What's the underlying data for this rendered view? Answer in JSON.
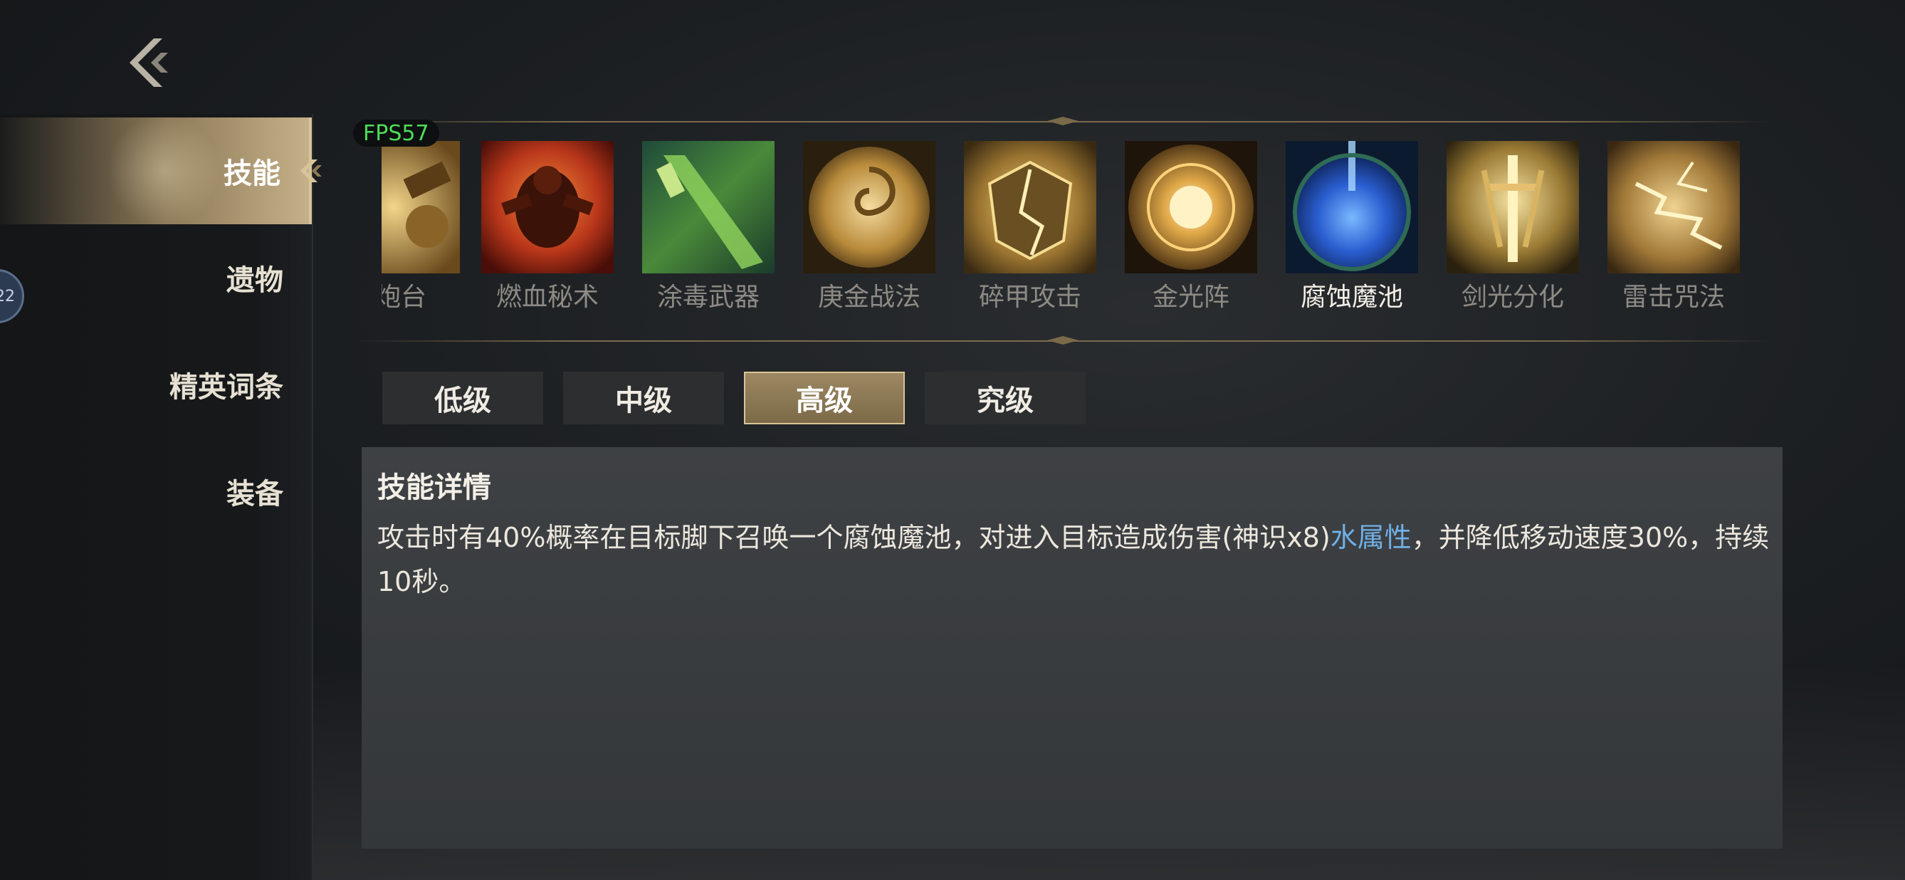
{
  "sidebar": {
    "items": [
      {
        "label": "技能",
        "active": true
      },
      {
        "label": "遗物",
        "active": false
      },
      {
        "label": "精英词条",
        "active": false
      },
      {
        "label": "装备",
        "active": false
      }
    ],
    "edge_badge": "22"
  },
  "fps": "FPS57",
  "skills": [
    {
      "name": "炮台",
      "icon": "turret-icon"
    },
    {
      "name": "燃血秘术",
      "icon": "burning-blood-icon"
    },
    {
      "name": "涂毒武器",
      "icon": "poison-weapon-icon"
    },
    {
      "name": "庚金战法",
      "icon": "metal-tactic-icon"
    },
    {
      "name": "碎甲攻击",
      "icon": "armor-break-icon"
    },
    {
      "name": "金光阵",
      "icon": "golden-array-icon"
    },
    {
      "name": "腐蚀魔池",
      "icon": "corrosion-pool-icon",
      "selected": true
    },
    {
      "name": "剑光分化",
      "icon": "sword-split-icon"
    },
    {
      "name": "雷击咒法",
      "icon": "thunder-spell-icon"
    }
  ],
  "tiers": [
    {
      "label": "低级",
      "active": false
    },
    {
      "label": "中级",
      "active": false
    },
    {
      "label": "高级",
      "active": true
    },
    {
      "label": "究级",
      "active": false
    }
  ],
  "detail": {
    "title": "技能详情",
    "text_before": "攻击时有40%概率在目标脚下召唤一个腐蚀魔池，对进入目标造成伤害(神识x8)",
    "element": "水属性",
    "text_after": "，并降低移动速度30%，持续10秒。"
  },
  "colors": {
    "accent_gold": "#d8c39a",
    "water_blue": "#6fb0e6",
    "fps_green": "#4fdc57"
  }
}
